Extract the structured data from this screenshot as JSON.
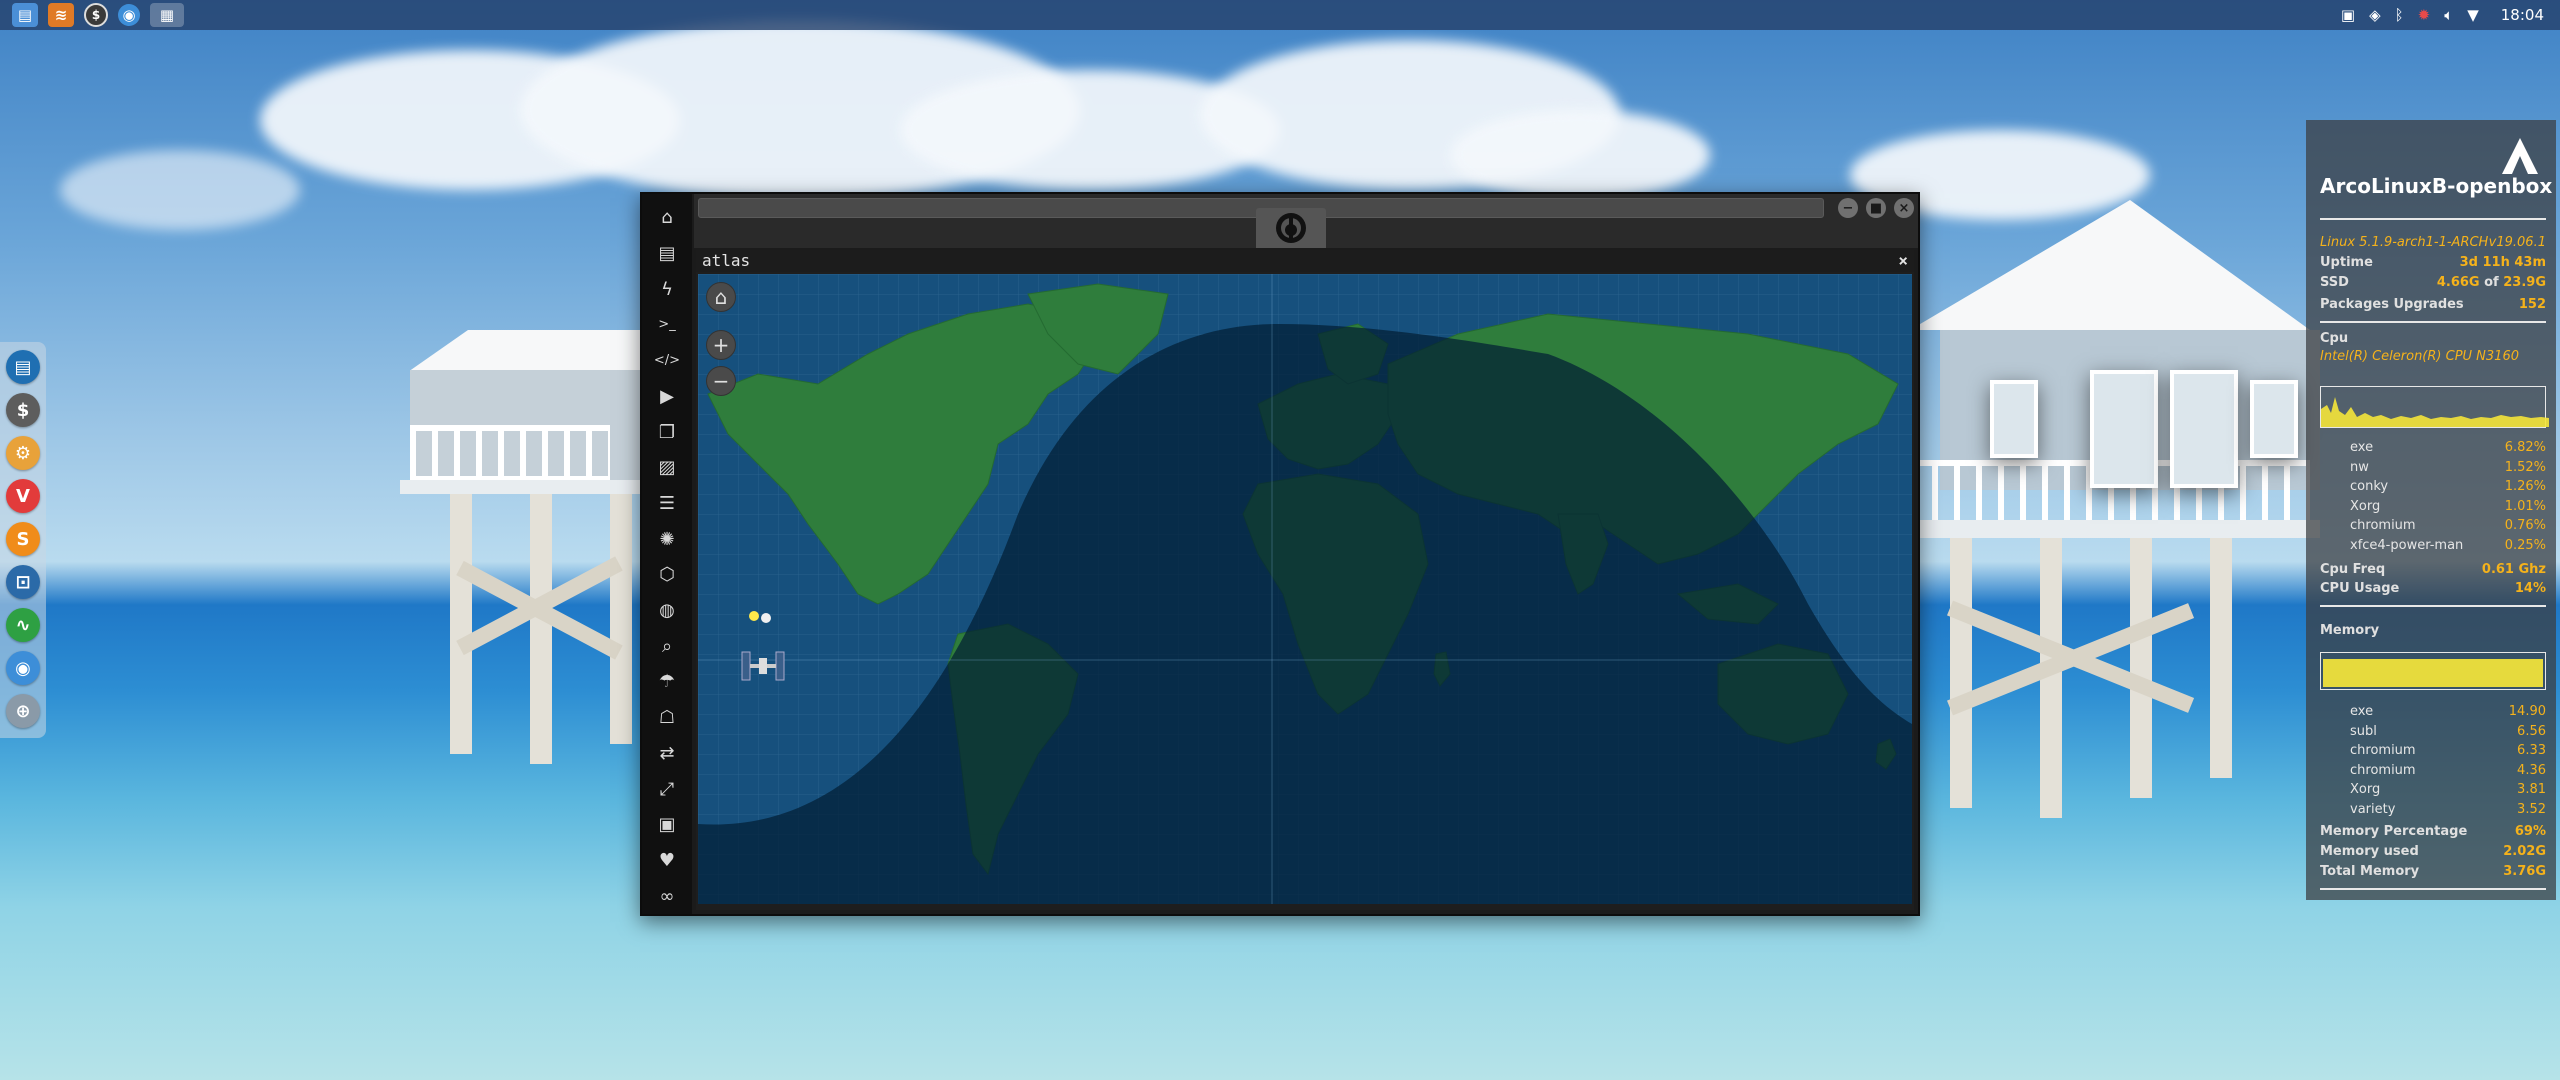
{
  "top_panel": {
    "apps": [
      "file-manager",
      "sublime-text",
      "variety",
      "chromium",
      "workspace"
    ],
    "clock": "18:04",
    "tray": [
      "screenshot-icon",
      "dropbox-icon",
      "bluetooth-icon",
      "update-icon",
      "volume-icon",
      "wifi-icon"
    ]
  },
  "dock": {
    "items": [
      {
        "name": "files",
        "color": "#1f6fb2",
        "glyph": "▤"
      },
      {
        "name": "variety",
        "color": "#5d5d5d",
        "glyph": "$"
      },
      {
        "name": "hardinfo",
        "color": "#e8a23a",
        "glyph": "⚙"
      },
      {
        "name": "vivaldi",
        "color": "#e23b3b",
        "glyph": "V"
      },
      {
        "name": "sublime",
        "color": "#f08c1a",
        "glyph": "S"
      },
      {
        "name": "screen",
        "color": "#2b6aa8",
        "glyph": "⊡"
      },
      {
        "name": "system-monitor",
        "color": "#2ea043",
        "glyph": "∿"
      },
      {
        "name": "chromium",
        "color": "#3d8ed8",
        "glyph": "◉"
      },
      {
        "name": "network",
        "color": "#8a9aa8",
        "glyph": "⊕"
      }
    ]
  },
  "window": {
    "side_icons": [
      "home",
      "document",
      "bolt",
      "terminal",
      "code",
      "play",
      "copy",
      "image",
      "news",
      "settings",
      "hexagon",
      "globe",
      "search",
      "umbrella",
      "contact",
      "exchange",
      "expand",
      "youtube",
      "heart",
      "infinity"
    ],
    "panel_title": "atlas",
    "close_label": "×",
    "map": {
      "home_label": "⌂",
      "zoom_in_label": "+",
      "zoom_out_label": "−",
      "colors": {
        "ocean": "#16507d",
        "land": "#2f7d3c",
        "night": "rgba(2,30,52,0.72)"
      }
    }
  },
  "conky": {
    "hostname": "ArcoLinuxB-openbox",
    "kernel": "Linux 5.1.9-arch1-1-ARCH",
    "version": "v19.06.1",
    "uptime_label": "Uptime",
    "uptime_value": "3d 11h 43m",
    "ssd_label": "SSD",
    "ssd_used": "4.66G",
    "ssd_of": "of",
    "ssd_total": "23.9G",
    "packages_label": "Packages Upgrades",
    "packages_value": "152",
    "cpu_section": "Cpu",
    "cpu_model": "Intel(R) Celeron(R) CPU  N3160",
    "cpu_procs": [
      {
        "name": "exe",
        "value": "6.82%"
      },
      {
        "name": "nw",
        "value": "1.52%"
      },
      {
        "name": "conky",
        "value": "1.26%"
      },
      {
        "name": "Xorg",
        "value": "1.01%"
      },
      {
        "name": "chromium",
        "value": "0.76%"
      },
      {
        "name": "xfce4-power-man",
        "value": "0.25%"
      }
    ],
    "cpu_freq_label": "Cpu Freq",
    "cpu_freq_value": "0.61 Ghz",
    "cpu_usage_label": "CPU Usage",
    "cpu_usage_value": "14%",
    "memory_section": "Memory",
    "mem_procs": [
      {
        "name": "exe",
        "value": "14.90"
      },
      {
        "name": "subl",
        "value": "6.56"
      },
      {
        "name": "chromium",
        "value": "6.33"
      },
      {
        "name": "chromium",
        "value": "4.36"
      },
      {
        "name": "Xorg",
        "value": "3.81"
      },
      {
        "name": "variety",
        "value": "3.52"
      }
    ],
    "mem_pct_label": "Memory Percentage",
    "mem_pct_value": "69%",
    "mem_used_label": "Memory used",
    "mem_used_value": "2.02G",
    "mem_total_label": "Total Memory",
    "mem_total_value": "3.76G",
    "accent_color": "#f5b21b"
  }
}
